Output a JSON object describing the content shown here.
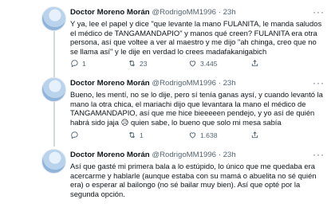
{
  "tweets": [
    {
      "author": "Doctor Moreno Morán",
      "handle": "@RodrigoMM1996",
      "dot": "·",
      "time": "23h",
      "lines": [
        "Y ya, lee el papel y dice \"que levante la mano FULANITA, le manda saludos",
        "el médico de TANGAMANDAPIO\" y manos qué creen? FULANITA era otra",
        "persona, así que voltee a ver al maestro y me dijo \"ah chinga, creo que no",
        "se llama así\" y le dije en verdad lo crees madafakanigabich"
      ],
      "replies": "1",
      "retweets": "23",
      "likes": "3.445"
    },
    {
      "author": "Doctor Moreno Morán",
      "handle": "@RodrigoMM1996",
      "dot": "·",
      "time": "23h",
      "lines": [
        "Bueno, les mentí, no se lo dije, pero sí tenía ganas aysí, y cuando levantó la",
        "mano la otra chica, el mariachi dijo que levantara la mano el médico de",
        "TANGAMANDAPIO, así que me hice bieeeeen pendejo, y yo así de quién",
        "habrá sido jaja 😥 quien sabe, lo bueno que solo mi mesa sabía"
      ],
      "replies": "",
      "retweets": "1",
      "likes": "1.638"
    },
    {
      "author": "Doctor Moreno Morán",
      "handle": "@RodrigoMM1996",
      "dot": "·",
      "time": "23h",
      "lines": [
        "Así que gasté mi primera bala a lo estúpido, lo único que me quedaba era",
        "acercarme y hablarle (aunque estaba con su mamá o abuelita no sé quién",
        "era) o esperar al bailongo (no sé bailar muy bien). Así que opté por la",
        "segunda opción."
      ],
      "replies": "",
      "retweets": "",
      "likes": ""
    }
  ],
  "more_icon": "more-dots-icon",
  "colors": {
    "text": "#0f1419",
    "secondary": "#536471",
    "thread_line": "#cfd9de"
  }
}
